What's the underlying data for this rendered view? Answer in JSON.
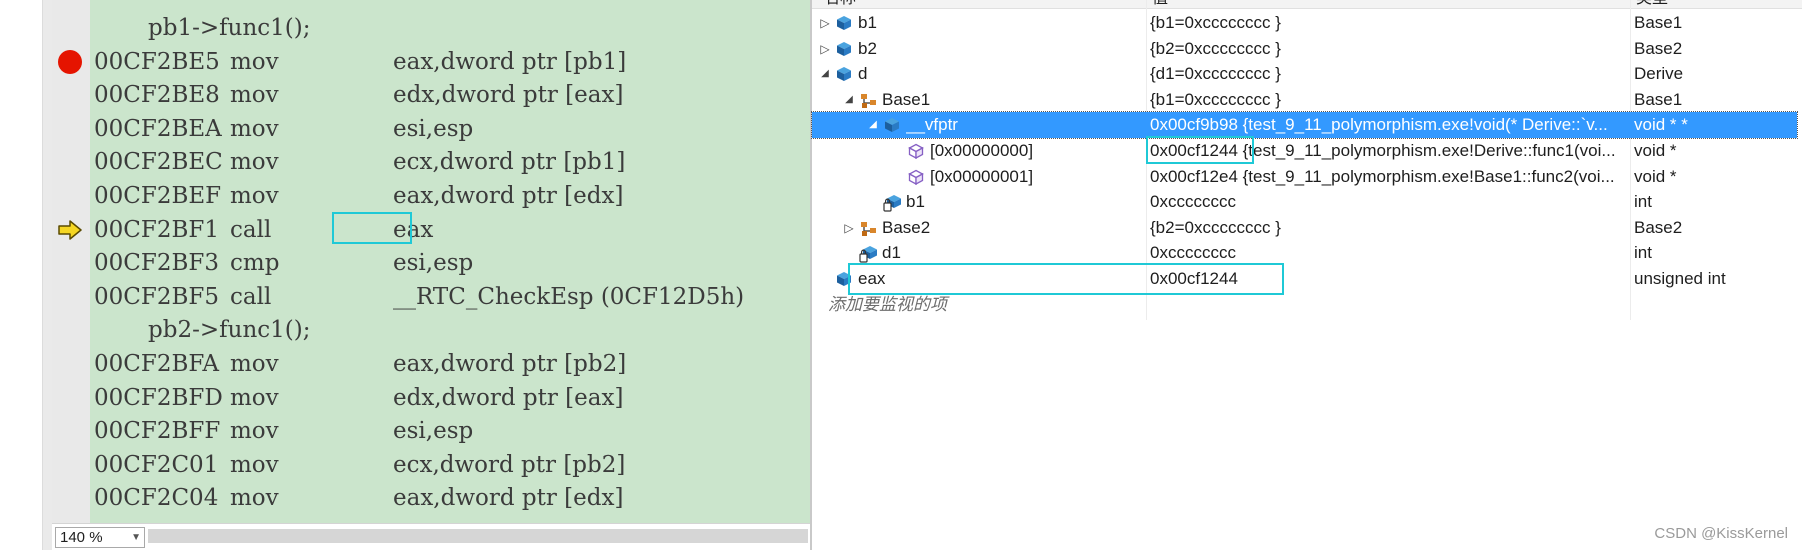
{
  "disassembly": {
    "lines": [
      {
        "kind": "src",
        "text": "pb1->func1();"
      },
      {
        "kind": "asm",
        "addr": "00CF2BE5",
        "op": "mov",
        "arg": "eax,dword ptr [pb1]",
        "marker": "breakpoint"
      },
      {
        "kind": "asm",
        "addr": "00CF2BE8",
        "op": "mov",
        "arg": "edx,dword ptr [eax]"
      },
      {
        "kind": "asm",
        "addr": "00CF2BEA",
        "op": "mov",
        "arg": "esi,esp"
      },
      {
        "kind": "asm",
        "addr": "00CF2BEC",
        "op": "mov",
        "arg": "ecx,dword ptr [pb1]"
      },
      {
        "kind": "asm",
        "addr": "00CF2BEF",
        "op": "mov",
        "arg": "eax,dword ptr [edx]"
      },
      {
        "kind": "asm",
        "addr": "00CF2BF1",
        "op": "call",
        "arg": "eax",
        "marker": "current",
        "highlight": true
      },
      {
        "kind": "asm",
        "addr": "00CF2BF3",
        "op": "cmp",
        "arg": "esi,esp"
      },
      {
        "kind": "asm",
        "addr": "00CF2BF5",
        "op": "call",
        "arg": "__RTC_CheckEsp (0CF12D5h)"
      },
      {
        "kind": "src",
        "text": "pb2->func1();"
      },
      {
        "kind": "asm",
        "addr": "00CF2BFA",
        "op": "mov",
        "arg": "eax,dword ptr [pb2]"
      },
      {
        "kind": "asm",
        "addr": "00CF2BFD",
        "op": "mov",
        "arg": "edx,dword ptr [eax]"
      },
      {
        "kind": "asm",
        "addr": "00CF2BFF",
        "op": "mov",
        "arg": "esi,esp"
      },
      {
        "kind": "asm",
        "addr": "00CF2C01",
        "op": "mov",
        "arg": "ecx,dword ptr [pb2]"
      },
      {
        "kind": "asm",
        "addr": "00CF2C04",
        "op": "mov",
        "arg": "eax,dword ptr [edx]"
      }
    ],
    "zoom": "140 %"
  },
  "watch": {
    "columns": {
      "name": "名称",
      "value": "值",
      "type": "类型"
    },
    "rows": [
      {
        "name": "b1",
        "value": "{b1=0xcccccccc }",
        "type": "Base1",
        "indent": 0,
        "arrow": "collapsed",
        "icon": "variable-icon"
      },
      {
        "name": "b2",
        "value": "{b2=0xcccccccc }",
        "type": "Base2",
        "indent": 0,
        "arrow": "collapsed",
        "icon": "variable-icon"
      },
      {
        "name": "d",
        "value": "{d1=0xcccccccc }",
        "type": "Derive",
        "indent": 0,
        "arrow": "expanded",
        "icon": "variable-icon"
      },
      {
        "name": "Base1",
        "value": "{b1=0xcccccccc }",
        "type": "Base1",
        "indent": 1,
        "arrow": "expanded",
        "icon": "base-class-icon"
      },
      {
        "name": "__vfptr",
        "value": "0x00cf9b98 {test_9_11_polymorphism.exe!void(* Derive::`v...",
        "type": "void * *",
        "indent": 2,
        "arrow": "expanded",
        "icon": "variable-icon",
        "selected": true
      },
      {
        "name": "[0x00000000]",
        "value": "0x00cf1244 {test_9_11_polymorphism.exe!Derive::func1(voi...",
        "type": "void *",
        "indent": 3,
        "arrow": "none",
        "icon": "element-icon",
        "value_highlight": true
      },
      {
        "name": "[0x00000001]",
        "value": "0x00cf12e4 {test_9_11_polymorphism.exe!Base1::func2(voi...",
        "type": "void *",
        "indent": 3,
        "arrow": "none",
        "icon": "element-icon"
      },
      {
        "name": "b1",
        "value": "0xcccccccc",
        "type": "int",
        "indent": 2,
        "arrow": "none",
        "icon": "member-icon"
      },
      {
        "name": "Base2",
        "value": "{b2=0xcccccccc }",
        "type": "Base2",
        "indent": 1,
        "arrow": "collapsed",
        "icon": "base-class-icon"
      },
      {
        "name": "d1",
        "value": "0xcccccccc",
        "type": "int",
        "indent": 1,
        "arrow": "none",
        "icon": "member-icon"
      },
      {
        "name": "eax",
        "value": "0x00cf1244",
        "type": "unsigned int",
        "indent": 0,
        "arrow": "none",
        "icon": "variable-icon",
        "row_highlight": true
      }
    ],
    "add_watch_placeholder": "添加要监视的项"
  },
  "watermark": "CSDN @KissKernel",
  "colors": {
    "code_background": "#cbe5cc",
    "highlight_box": "#1fc9d6",
    "selection": "#3399ff",
    "breakpoint": "#e51400",
    "current_instruction": "#f5d623"
  }
}
